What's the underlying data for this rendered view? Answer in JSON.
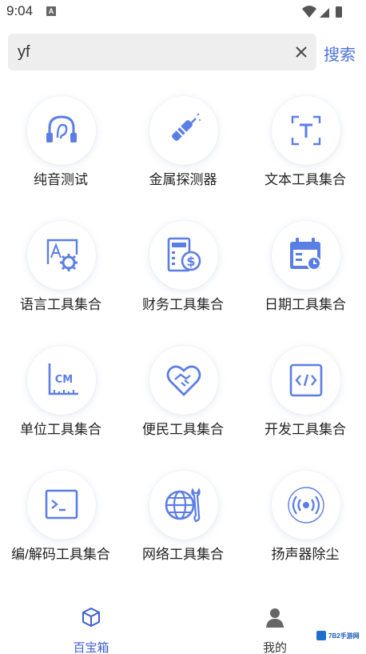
{
  "status_bar": {
    "time": "9:04",
    "notification": "A"
  },
  "search": {
    "value": "yf",
    "button_label": "搜索"
  },
  "tools": [
    {
      "label": "纯音测试",
      "icon": "headphones-icon"
    },
    {
      "label": "金属探测器",
      "icon": "metal-detector-icon"
    },
    {
      "label": "文本工具集合",
      "icon": "text-icon"
    },
    {
      "label": "语言工具集合",
      "icon": "language-icon"
    },
    {
      "label": "财务工具集合",
      "icon": "finance-icon"
    },
    {
      "label": "日期工具集合",
      "icon": "calendar-icon"
    },
    {
      "label": "单位工具集合",
      "icon": "unit-ruler-icon"
    },
    {
      "label": "便民工具集合",
      "icon": "heart-handshake-icon"
    },
    {
      "label": "开发工具集合",
      "icon": "code-icon"
    },
    {
      "label": "编/解码工具集合",
      "icon": "terminal-icon"
    },
    {
      "label": "网络工具集合",
      "icon": "network-icon"
    },
    {
      "label": "扬声器除尘",
      "icon": "speaker-icon"
    }
  ],
  "bottom_nav": [
    {
      "label": "百宝箱",
      "icon": "cube-icon",
      "active": true
    },
    {
      "label": "我的",
      "icon": "user-icon",
      "active": false
    }
  ],
  "watermark": {
    "text": "7B2手游网"
  },
  "colors": {
    "accent": "#4a72d8",
    "icon_blue": "#5b7ee6",
    "nav_active": "#3d5fd0"
  }
}
